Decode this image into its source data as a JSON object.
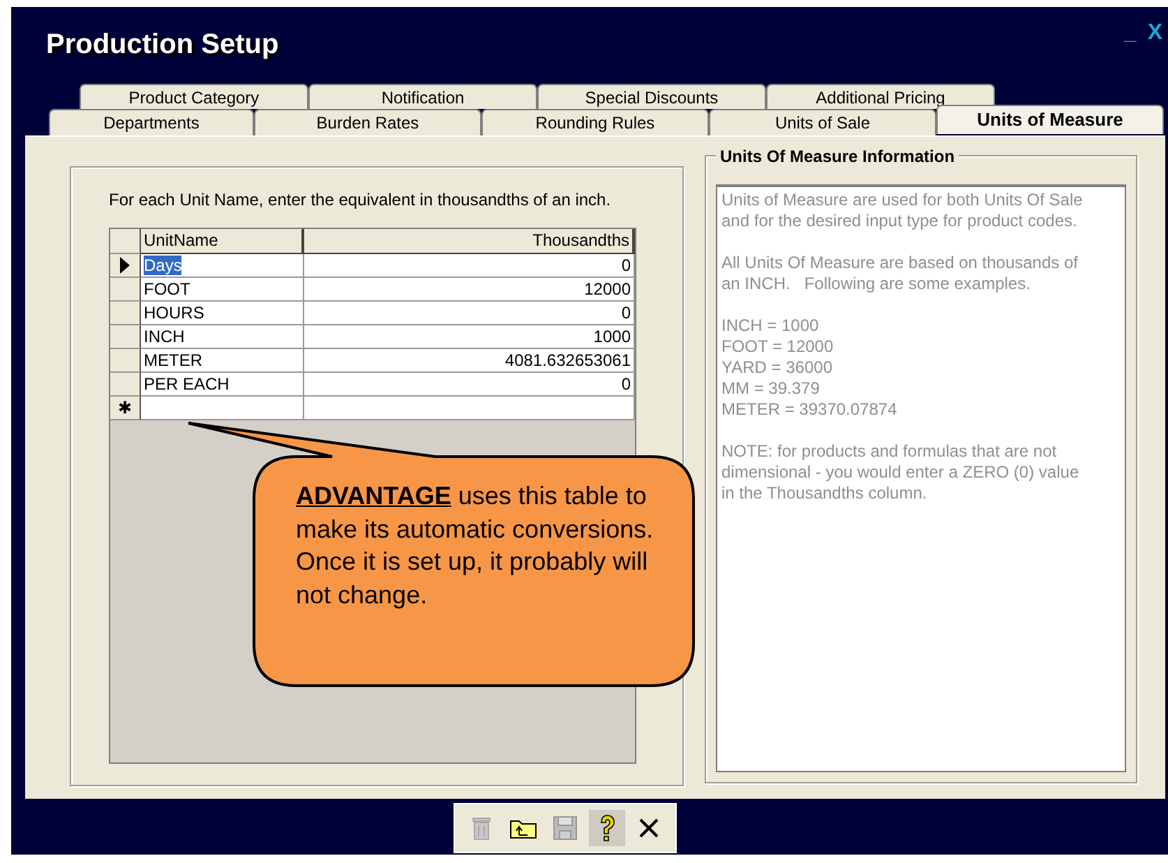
{
  "window": {
    "title": "Production Setup",
    "minimize": "_",
    "close": "X"
  },
  "tab_rows": [
    [
      {
        "label": "Product Category",
        "selected": false
      },
      {
        "label": "Notification",
        "selected": false
      },
      {
        "label": "Special Discounts",
        "selected": false
      },
      {
        "label": "Additional Pricing",
        "selected": false
      }
    ],
    [
      {
        "label": "Departments",
        "selected": false
      },
      {
        "label": "Burden Rates",
        "selected": false
      },
      {
        "label": "Rounding Rules",
        "selected": false
      },
      {
        "label": "Units of Sale",
        "selected": false
      },
      {
        "label": "Units of Measure",
        "selected": true
      }
    ]
  ],
  "instruction": "For each Unit Name, enter the equivalent in thousandths of an inch.",
  "table": {
    "columns": [
      "UnitName",
      "Thousandths"
    ],
    "rows": [
      {
        "unit": "Days",
        "thousandths": "0",
        "selected": true
      },
      {
        "unit": "FOOT",
        "thousandths": "12000",
        "selected": false
      },
      {
        "unit": "HOURS",
        "thousandths": "0",
        "selected": false
      },
      {
        "unit": "INCH",
        "thousandths": "1000",
        "selected": false
      },
      {
        "unit": "METER",
        "thousandths": "4081.632653061",
        "selected": false
      },
      {
        "unit": "PER EACH",
        "thousandths": "0",
        "selected": false
      }
    ],
    "new_row_marker": "✱"
  },
  "info": {
    "title": "Units Of Measure Information",
    "paragraphs": [
      "Units of Measure are used for both Units Of Sale\nand for the desired input type for product codes.",
      "All Units Of Measure are based on thousands of\nan INCH.   Following are some examples.",
      "INCH = 1000\nFOOT = 12000\nYARD = 36000\nMM = 39.379\nMETER = 39370.07874",
      "NOTE: for products and formulas that are not\ndimensional - you would enter a ZERO (0) value\nin the Thousandths column."
    ]
  },
  "callout": {
    "text": "**ADVANTAGE** uses this table to make its automatic conversions. Once it is set up, it probably will not change."
  },
  "toolbar": [
    {
      "kind": "delete",
      "disabled": true,
      "pressed": false
    },
    {
      "kind": "open",
      "disabled": false,
      "pressed": false
    },
    {
      "kind": "save",
      "disabled": true,
      "pressed": false
    },
    {
      "kind": "help",
      "disabled": false,
      "pressed": true
    },
    {
      "kind": "close",
      "disabled": false,
      "pressed": false
    }
  ]
}
